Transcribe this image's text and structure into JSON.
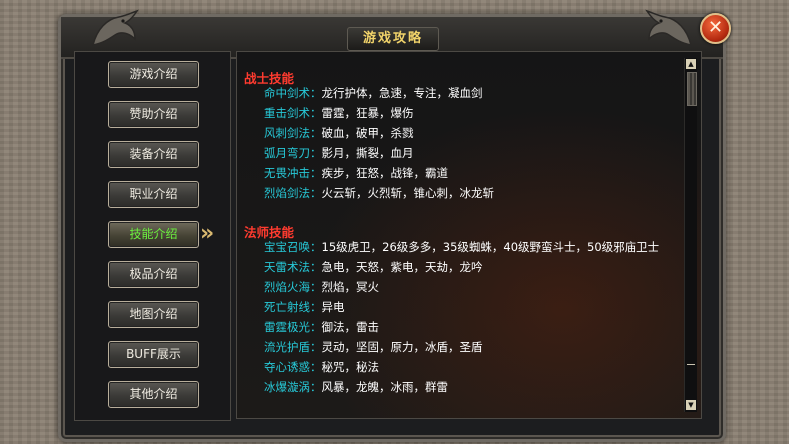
{
  "window": {
    "title": "游戏攻略",
    "close_label": "✕"
  },
  "nav": {
    "items": [
      {
        "label": "游戏介绍",
        "active": false
      },
      {
        "label": "赞助介绍",
        "active": false
      },
      {
        "label": "装备介绍",
        "active": false
      },
      {
        "label": "职业介绍",
        "active": false
      },
      {
        "label": "技能介绍",
        "active": true
      },
      {
        "label": "极品介绍",
        "active": false
      },
      {
        "label": "地图介绍",
        "active": false
      },
      {
        "label": "BUFF展示",
        "active": false
      },
      {
        "label": "其他介绍",
        "active": false
      }
    ],
    "active_arrow": "»"
  },
  "sections": [
    {
      "title": "战士技能",
      "rows": [
        {
          "key": "命中剑术：",
          "value": "龙行护体，急速，专注，凝血剑"
        },
        {
          "key": "重击剑术：",
          "value": "雷霆，狂暴，爆伤"
        },
        {
          "key": "风刺剑法：",
          "value": "破血，破甲，杀戮"
        },
        {
          "key": "弧月弯刀：",
          "value": "影月，撕裂，血月"
        },
        {
          "key": "无畏冲击：",
          "value": "疾步，狂怒，战锋，霸道"
        },
        {
          "key": "烈焰剑法：",
          "value": "火云斩，火烈斩，锥心刺，冰龙斩"
        }
      ]
    },
    {
      "title": "法师技能",
      "rows": [
        {
          "key": "宝宝召唤：",
          "value": "15级虎卫，26级多多，35级蜘蛛，40级野蛮斗士，50级邪庙卫士"
        },
        {
          "key": "天雷术法：",
          "value": "急电，天怒，紫电，天劫，龙吟"
        },
        {
          "key": "烈焰火海：",
          "value": "烈焰，冥火"
        },
        {
          "key": "死亡射线：",
          "value": "异电"
        },
        {
          "key": "雷霆极光：",
          "value": "御法，雷击"
        },
        {
          "key": "流光护盾：",
          "value": "灵动，坚固，原力，冰盾，圣盾"
        },
        {
          "key": "夺心诱惑：",
          "value": "秘咒，秘法"
        },
        {
          "key": "冰爆漩涡：",
          "value": "风暴，龙魄，冰雨，群雷"
        }
      ]
    }
  ],
  "scrollbar": {
    "up": "▲",
    "down": "▼"
  },
  "colors": {
    "section_title": "#ff3b2f",
    "skill_key": "#27c9d8",
    "skill_value": "#ffffff",
    "title_text": "#f1d36a",
    "active_nav": "#6cf23f"
  }
}
